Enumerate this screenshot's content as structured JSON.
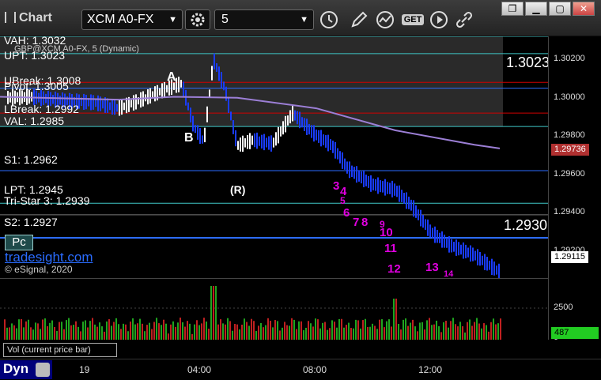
{
  "app": {
    "title": "Chart"
  },
  "toolbar": {
    "symbol": "XCM A0-FX",
    "interval": "5",
    "icons": [
      "settings-gear-icon",
      "clock-icon",
      "pencil-icon",
      "study-icon",
      "get-icon",
      "play-icon",
      "link-icon"
    ],
    "get_label": "GET"
  },
  "window_buttons": [
    "restore",
    "minimize",
    "maximize",
    "close"
  ],
  "chart": {
    "series_title": "GBP@XCM A0-FX, 5 (Dynamic)",
    "branding": "tradesight.com",
    "copyright": "© eSignal, 2020",
    "pc_badge": "Pc",
    "levels": [
      {
        "label": "VAH: 1.3032",
        "price": 1.3032,
        "color": "#3fc8c8"
      },
      {
        "label": "UPT: 1.3023",
        "price": 1.3023,
        "color": "#3fc8c8"
      },
      {
        "label": "UBreak: 1.3008",
        "price": 1.3008,
        "color": "#d00000"
      },
      {
        "label": "Pivot: 1.3005",
        "price": 1.3005,
        "color": "#2d6dff"
      },
      {
        "label": "LBreak: 1.2992",
        "price": 1.2992,
        "color": "#d00000"
      },
      {
        "label": "VAL: 1.2985",
        "price": 1.2985,
        "color": "#3fc8c8"
      },
      {
        "label": "S1: 1.2962",
        "price": 1.2962,
        "color": "#2d6dff"
      },
      {
        "label": "LPT: 1.2945",
        "price": 1.2945,
        "color": "#3fc8c8"
      },
      {
        "label": "Tri-Star 3: 1.2939",
        "price": 1.2939,
        "color": "#7a7a7a"
      },
      {
        "label": "S2: 1.2927",
        "price": 1.2927,
        "color": "#2d6dff"
      }
    ],
    "big_labels": [
      {
        "text": "1.3023",
        "color": "#1fa51f"
      },
      {
        "text": "1.2930",
        "color": "#ff2020"
      }
    ],
    "markers": [
      {
        "text": "A",
        "color": "#ffff00"
      },
      {
        "text": "B",
        "color": "#ffff00"
      },
      {
        "text": "(R)",
        "color": "#b01010"
      }
    ],
    "counts": [
      "3",
      "4",
      "5",
      "6",
      "7",
      "8",
      "9",
      "10",
      "11",
      "12",
      "13",
      "14"
    ],
    "y_ticks": [
      "1.30200",
      "1.30000",
      "1.29800",
      "1.29600",
      "1.29400",
      "1.29200"
    ],
    "y_range": [
      1.2906,
      1.3032
    ],
    "last_price": "1.29736",
    "current_price": "1.29115",
    "vol_ticks": [
      "2500",
      "0"
    ],
    "vol_current": "487",
    "vol_label": "Vol (current price bar)"
  },
  "time_axis": {
    "dyn_label": "Dyn",
    "labels": [
      "19",
      "04:00",
      "08:00",
      "12:00"
    ]
  },
  "colors": {
    "price_bar": "#ffffff",
    "down_bar": "#1a3cff",
    "ma": "#9c7fd6",
    "vol_up": "#1fa51f",
    "vol_down": "#c02020"
  }
}
